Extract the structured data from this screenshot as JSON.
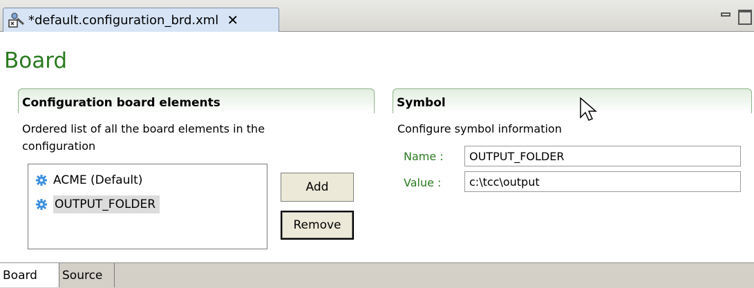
{
  "editor_tab": {
    "title": "*default.configuration_brd.xml",
    "close_glyph": "✕",
    "icon": "configuration-file-icon"
  },
  "page_title": "Board",
  "left_section": {
    "header": "Configuration board elements",
    "description_line1": "Ordered list of all the board elements in the",
    "description_line2": "configuration",
    "items": [
      {
        "label": "ACME (Default)",
        "icon": "gear-icon",
        "selected": false
      },
      {
        "label": "OUTPUT_FOLDER",
        "icon": "gear-icon",
        "selected": true
      }
    ],
    "add_label": "Add",
    "remove_label": "Remove"
  },
  "right_section": {
    "header": "Symbol",
    "description": "Configure symbol information",
    "name_label": "Name :",
    "name_value": "OUTPUT_FOLDER",
    "value_label": "Value :",
    "value_value": "c:\\tcc\\output"
  },
  "bottom_tabs": [
    {
      "label": "Board",
      "active": true
    },
    {
      "label": "Source",
      "active": false
    }
  ],
  "colors": {
    "title_green": "#2a7a1f",
    "tab_blue": "#d6e4f5",
    "gear_blue": "#3a8fe0"
  }
}
